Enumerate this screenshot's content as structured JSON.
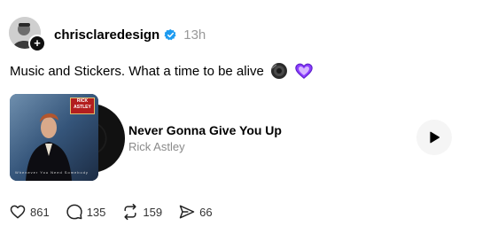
{
  "post": {
    "username": "chrisclaredesign",
    "timestamp": "13h",
    "text": "Music and Stickers. What a time to be alive",
    "follow_symbol": "+",
    "sticker_icons": [
      "speaker-sticker-icon",
      "purple-heart-sticker-icon"
    ]
  },
  "music": {
    "title": "Never Gonna Give You Up",
    "artist": "Rick Astley",
    "album_cover_text": "Whenever You Need Somebody",
    "album_logo_top": "RICK",
    "album_logo_bottom": "ASTLEY"
  },
  "actions": {
    "likes": "861",
    "replies": "135",
    "reposts": "159",
    "shares": "66"
  },
  "colors": {
    "verified": "#1d9bf0",
    "muted_text": "#999999",
    "play_bg": "#f5f5f5",
    "heart_sticker": "#8b3dff"
  }
}
